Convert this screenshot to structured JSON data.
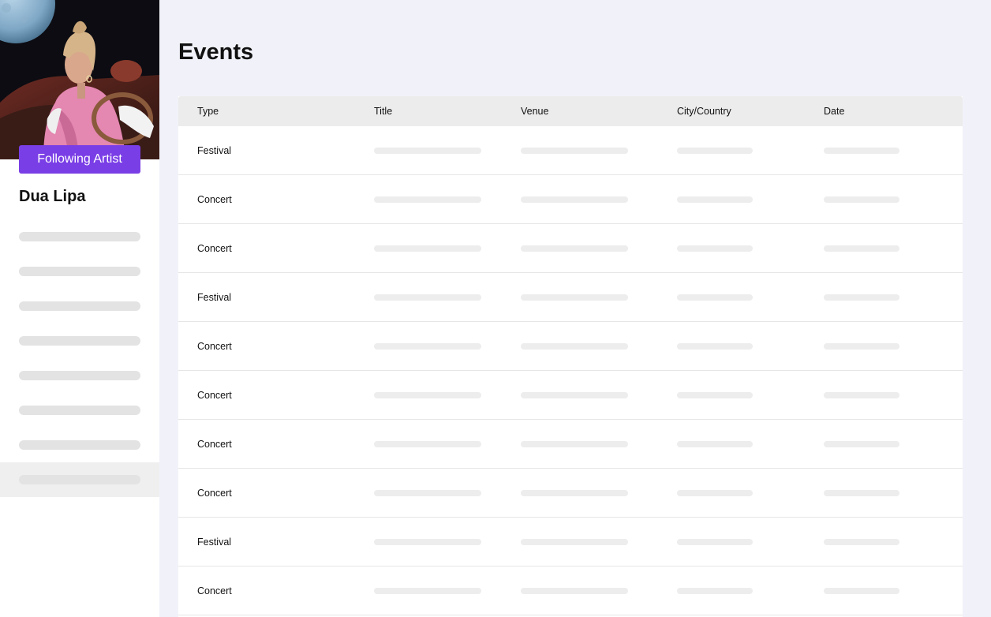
{
  "sidebar": {
    "artist_name": "Dua Lipa",
    "follow_label": "Following Artist",
    "item_count": 8,
    "active_index": 7
  },
  "main": {
    "title": "Events",
    "columns": [
      "Type",
      "Title",
      "Venue",
      "City/Country",
      "Date"
    ],
    "rows": [
      {
        "type": "Festival"
      },
      {
        "type": "Concert"
      },
      {
        "type": "Concert"
      },
      {
        "type": "Festival"
      },
      {
        "type": "Concert"
      },
      {
        "type": "Concert"
      },
      {
        "type": "Concert"
      },
      {
        "type": "Concert"
      },
      {
        "type": "Festival"
      },
      {
        "type": "Concert"
      }
    ]
  },
  "colors": {
    "accent": "#7a3ee6",
    "page_background": "#f1f2f9",
    "skeleton": "#e3e3e3"
  }
}
